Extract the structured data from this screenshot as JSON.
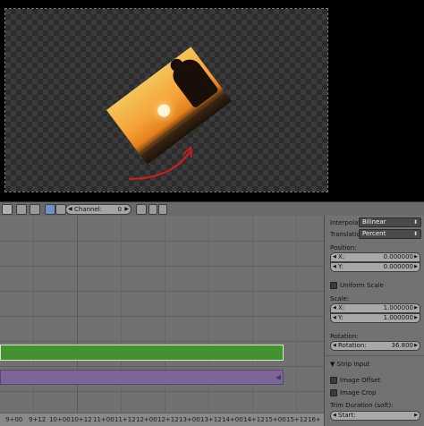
{
  "header": {
    "channel_label": "Channel:",
    "channel_value": "0"
  },
  "timeline": {
    "ruler_ticks": [
      "9+00",
      "9+12",
      "10+00",
      "10+12",
      "11+00",
      "11+12",
      "12+00",
      "12+12",
      "13+00",
      "13+12",
      "14+00",
      "14+12",
      "15+00",
      "15+12",
      "16+"
    ]
  },
  "panel": {
    "interpolation_label": "Interpolati",
    "interpolation_value": "Bilinear",
    "translation_label": "Translatio",
    "translation_value": "Percent",
    "position_heading": "Position:",
    "position_x_label": "X:",
    "position_x_value": "0.000000",
    "position_y_label": "Y:",
    "position_y_value": "0.000000",
    "uniform_scale_label": "Uniform Scale",
    "scale_heading": "Scale:",
    "scale_x_label": "X:",
    "scale_x_value": "1.000000",
    "scale_y_label": "Y:",
    "scale_y_value": "1.000000",
    "rotation_heading": "Rotation:",
    "rotation_label": "Rotation:",
    "rotation_value": "36.800",
    "strip_input_label": "Strip Input",
    "image_offset_label": "Image Offset",
    "image_crop_label": "Image Crop",
    "trim_heading": "Trim Duration (soft):",
    "start_label": "Start:"
  },
  "colors": {
    "green_strip": "#44922f",
    "purple_strip": "#7e6599",
    "arrow": "#d01e1e"
  }
}
